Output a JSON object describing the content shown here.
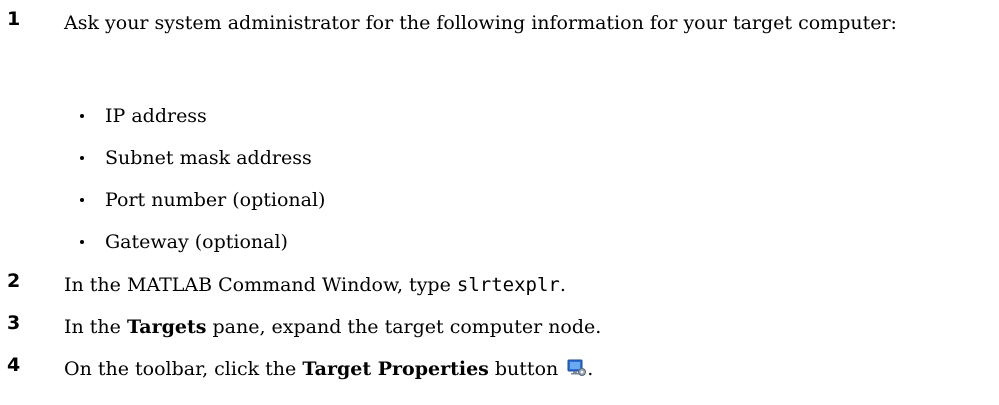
{
  "steps": [
    {
      "number": "1",
      "text": "Ask your system administrator for the following information for your target computer:",
      "bullets": [
        "IP address",
        "Subnet mask address",
        "Port number (optional)",
        "Gateway (optional)"
      ]
    },
    {
      "number": "2",
      "text_before": "In the MATLAB Command Window, type ",
      "code": "slrtexplr",
      "text_after": "."
    },
    {
      "number": "3",
      "text_before": "In the ",
      "bold": "Targets",
      "text_after": " pane, expand the target computer node."
    },
    {
      "number": "4",
      "text_before": "On the toolbar, click the ",
      "bold": "Target Properties",
      "text_middle": " button ",
      "icon": "target-properties-icon",
      "text_after": "."
    }
  ],
  "colors": {
    "text": "#000000",
    "background": "#ffffff",
    "icon_primary": "#2a6fd6",
    "icon_secondary": "#9aa8b8"
  }
}
